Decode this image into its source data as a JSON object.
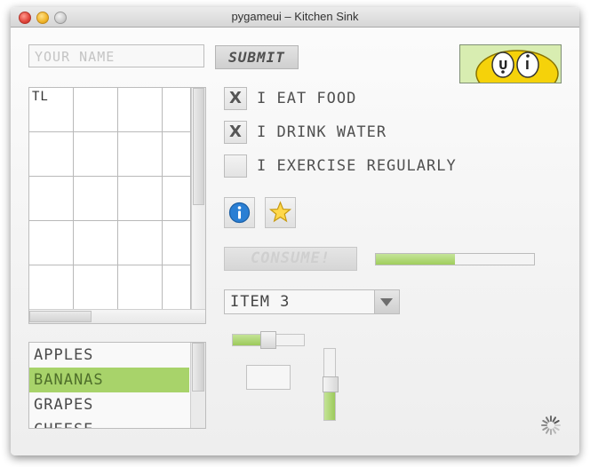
{
  "window": {
    "title": "pygameui – Kitchen Sink"
  },
  "form": {
    "name_placeholder": "YOUR NAME",
    "submit_label": "SUBMIT"
  },
  "grid": {
    "top_left_label": "TL",
    "rows": 5,
    "cols": 4
  },
  "checkboxes": [
    {
      "label": "I EAT FOOD",
      "checked": true,
      "mark": "X"
    },
    {
      "label": "I DRINK WATER",
      "checked": true,
      "mark": "X"
    },
    {
      "label": "I EXERCISE REGULARLY",
      "checked": false,
      "mark": ""
    }
  ],
  "icons": {
    "info": "info-icon",
    "star": "star-icon",
    "spinner": "spinner-icon"
  },
  "consume": {
    "label": "CONSUME!",
    "progress": 0.5
  },
  "select": {
    "value": "ITEM 3"
  },
  "list": {
    "items": [
      "APPLES",
      "BANANAS",
      "GRAPES",
      "CHEESE"
    ],
    "selected_index": 1
  },
  "sliders": {
    "horizontal_value": 0.5,
    "vertical_value": 0.5
  },
  "colors": {
    "accent": "#a8d36a",
    "accent_text": "#4f6f2b",
    "logo_bg": "#d8edb1"
  }
}
